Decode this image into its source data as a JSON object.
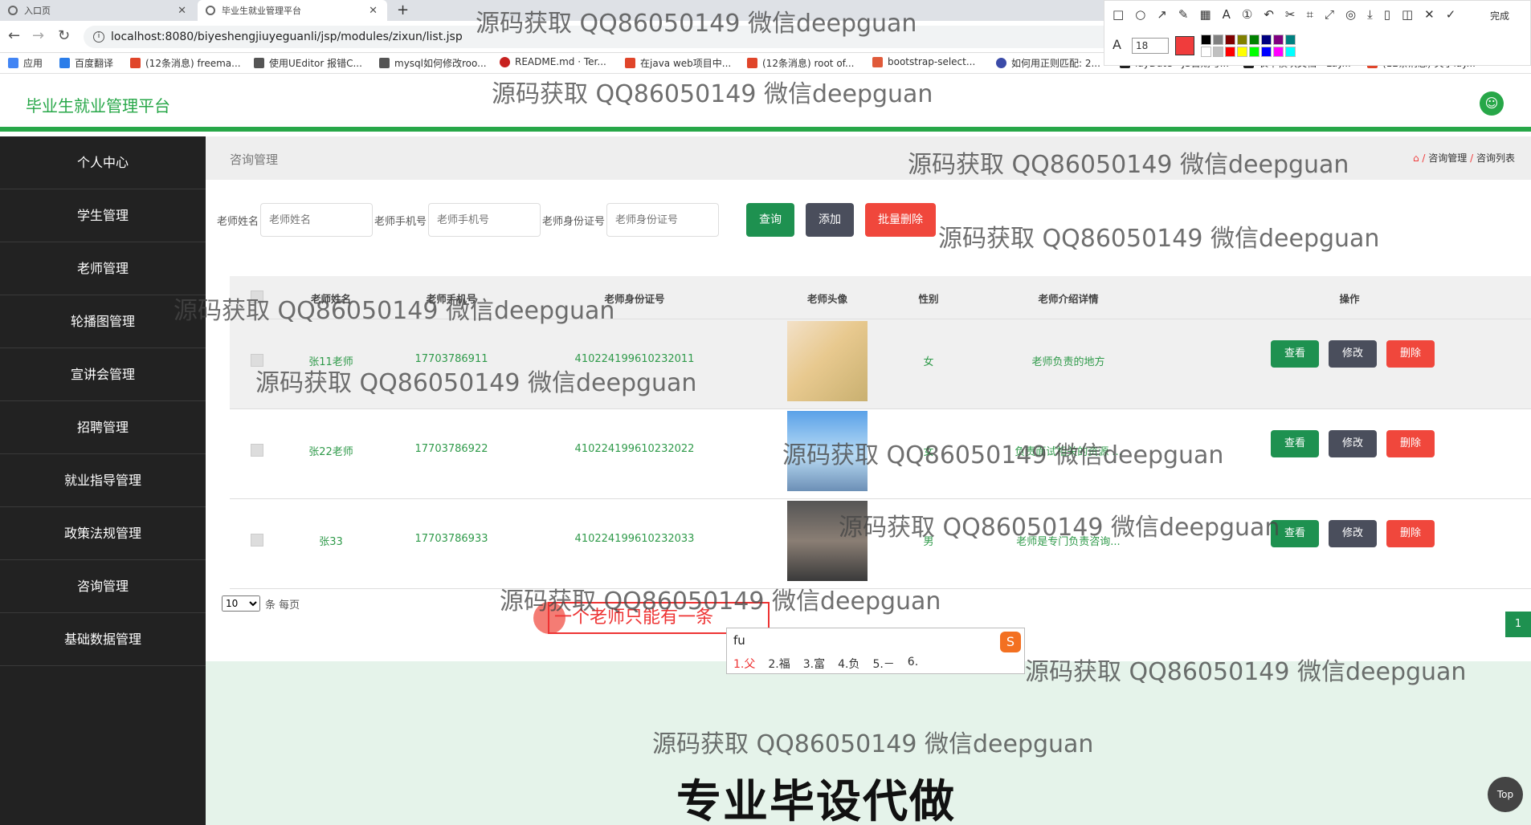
{
  "browser": {
    "tabs": [
      {
        "label": "入口页",
        "active": false
      },
      {
        "label": "毕业生就业管理平台",
        "active": true
      }
    ],
    "new_tab": "+",
    "url": "localhost:8080/biyeshengjiuyeguanli/jsp/modules/zixun/list.jsp",
    "bookmarks": [
      "应用",
      "百度翻译",
      "(12条消息) freema...",
      "使用UEditor 报错C...",
      "mysql如何修改roo...",
      "README.md · Ter...",
      "在java web项目中...",
      "(12条消息) root of...",
      "bootstrap-select...",
      "如何用正则匹配: 2...",
      "layDate - JS日期与...",
      "表单模块文档 - Lay...",
      "(12条消息) 关于lay..."
    ]
  },
  "annotation_toolbar": {
    "done_label": "完成",
    "font_size": "18",
    "selected_color": "#f03c3c",
    "palette": [
      "#000000",
      "#808080",
      "#800000",
      "#808000",
      "#008000",
      "#000080",
      "#800080",
      "#008080",
      "#ffffff",
      "#c0c0c0",
      "#ff0000",
      "#ffff00",
      "#00ff00",
      "#0000ff",
      "#ff00ff",
      "#00ffff"
    ]
  },
  "app": {
    "brand": "毕业生就业管理平台",
    "accent_color": "#27a748",
    "menu": [
      "个人中心",
      "学生管理",
      "老师管理",
      "轮播图管理",
      "宣讲会管理",
      "招聘管理",
      "就业指导管理",
      "政策法规管理",
      "咨询管理",
      "基础数据管理"
    ],
    "page_title": "咨询管理",
    "breadcrumb": [
      "咨询管理",
      "咨询列表"
    ],
    "search": {
      "fields": [
        {
          "label": "老师姓名",
          "placeholder": "老师姓名"
        },
        {
          "label": "老师手机号",
          "placeholder": "老师手机号"
        },
        {
          "label": "老师身份证号",
          "placeholder": "老师身份证号"
        }
      ],
      "query_label": "查询",
      "add_label": "添加",
      "batch_delete_label": "批量删除"
    },
    "table": {
      "headers": [
        "老师姓名",
        "老师手机号",
        "老师身份证号",
        "老师头像",
        "性别",
        "老师介绍详情",
        "操作"
      ],
      "rows": [
        {
          "name": "张11老师",
          "phone": "17703786911",
          "idcard": "410224199610232011",
          "gender": "女",
          "intro": "老师负责的地方"
        },
        {
          "name": "张22老师",
          "phone": "17703786922",
          "idcard": "410224199610232022",
          "gender": "女",
          "intro": "负责面试相关的资源 ..."
        },
        {
          "name": "张33",
          "phone": "17703786933",
          "idcard": "410224199610232033",
          "gender": "男",
          "intro": "老师是专门负责咨询..."
        }
      ],
      "actions": {
        "view": "查看",
        "edit": "修改",
        "delete": "删除"
      }
    },
    "pager": {
      "page_size": "10",
      "suffix": "条 每页",
      "current_page": "1"
    },
    "top_button": "Top"
  },
  "overlay": {
    "note_text": "一个老师只能有一条",
    "ime": {
      "pinyin": "fu",
      "candidates": [
        "1.父",
        "2.福",
        "3.富",
        "4.负",
        "5.－",
        "6."
      ]
    },
    "watermark": "源码获取 QQ86050149 微信deepguan",
    "big_watermark": "专业毕设代做"
  }
}
